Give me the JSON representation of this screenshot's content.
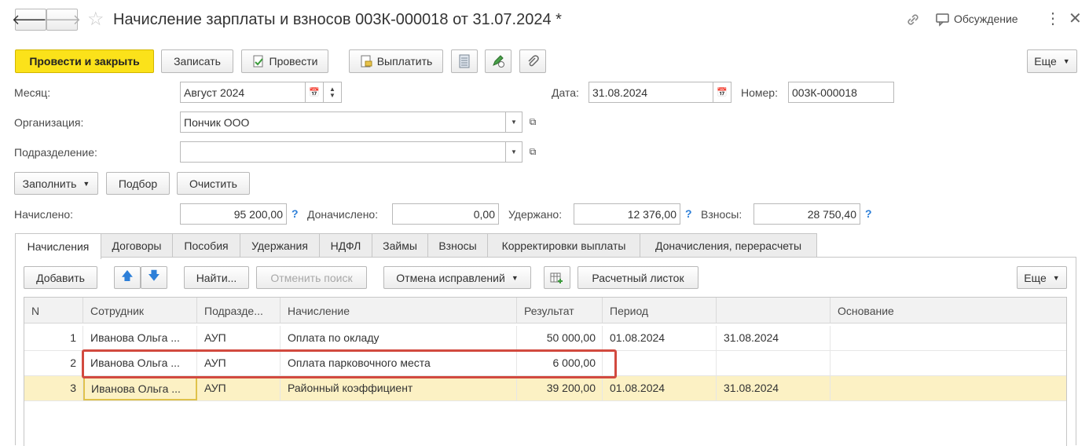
{
  "window": {
    "title": "Начисление зарплаты и взносов 003К-000018 от 31.07.2024 *",
    "discussion_label": "Обсуждение"
  },
  "toolbar": {
    "post_close": "Провести и закрыть",
    "save": "Записать",
    "post": "Провести",
    "pay": "Выплатить",
    "more": "Еще"
  },
  "form": {
    "month_label": "Месяц:",
    "month_value": "Август 2024",
    "date_label": "Дата:",
    "date_value": "31.08.2024",
    "number_label": "Номер:",
    "number_value": "003К-000018",
    "org_label": "Организация:",
    "org_value": "Пончик ООО",
    "dept_label": "Подразделение:",
    "dept_value": ""
  },
  "fill_bar": {
    "fill": "Заполнить",
    "select": "Подбор",
    "clear": "Очистить"
  },
  "totals": {
    "accrued_label": "Начислено:",
    "accrued_value": "95 200,00",
    "additional_label": "Доначислено:",
    "additional_value": "0,00",
    "withheld_label": "Удержано:",
    "withheld_value": "12 376,00",
    "contrib_label": "Взносы:",
    "contrib_value": "28 750,40",
    "help": "?"
  },
  "tabs": [
    {
      "label": "Начисления"
    },
    {
      "label": "Договоры"
    },
    {
      "label": "Пособия"
    },
    {
      "label": "Удержания"
    },
    {
      "label": "НДФЛ"
    },
    {
      "label": "Займы"
    },
    {
      "label": "Взносы"
    },
    {
      "label": "Корректировки выплаты"
    },
    {
      "label": "Доначисления, перерасчеты"
    }
  ],
  "table_toolbar": {
    "add": "Добавить",
    "find": "Найти...",
    "cancel_search": "Отменить поиск",
    "cancel_fix": "Отмена исправлений",
    "payslip": "Расчетный листок",
    "more": "Еще"
  },
  "table": {
    "columns": [
      "N",
      "Сотрудник",
      "Подразде...",
      "Начисление",
      "Результат",
      "Период",
      "",
      "Основание"
    ],
    "rows": [
      {
        "n": "1",
        "employee": "Иванова Ольга ...",
        "dept": "АУП",
        "accrual": "Оплата по окладу",
        "result": "50 000,00",
        "period_from": "01.08.2024",
        "period_to": "31.08.2024",
        "basis": ""
      },
      {
        "n": "2",
        "employee": "Иванова Ольга ...",
        "dept": "АУП",
        "accrual": "Оплата парковочного места",
        "result": "6 000,00",
        "period_from": "",
        "period_to": "",
        "basis": ""
      },
      {
        "n": "3",
        "employee": "Иванова Ольга ...",
        "dept": "АУП",
        "accrual": "Районный коэффициент",
        "result": "39 200,00",
        "period_from": "01.08.2024",
        "period_to": "31.08.2024",
        "basis": ""
      }
    ]
  },
  "colors": {
    "primary_button": "#fbe21a",
    "selected_row": "#fcf1c4",
    "highlight_frame": "#d24a3f",
    "help_blue": "#2d7fd8"
  }
}
